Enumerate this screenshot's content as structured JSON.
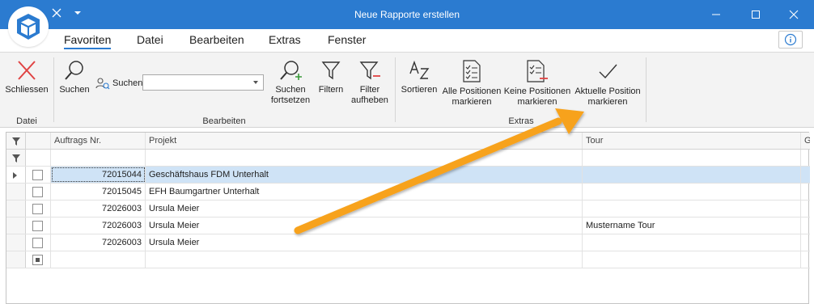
{
  "window": {
    "title": "Neue Rapporte erstellen"
  },
  "menu": {
    "tabs": [
      "Favoriten",
      "Datei",
      "Bearbeiten",
      "Extras",
      "Fenster"
    ]
  },
  "ribbon": {
    "close_label": "Schliessen",
    "group_datei": "Datei",
    "search_btn": "Suchen",
    "search_label": "Suchen",
    "search_value": "",
    "continue_line1": "Suchen",
    "continue_line2": "fortsetzen",
    "filter_label": "Filtern",
    "clear_filter_line1": "Filter",
    "clear_filter_line2": "aufheben",
    "group_bearbeiten": "Bearbeiten",
    "sort_label": "Sortieren",
    "mark_all_line1": "Alle Positionen",
    "mark_all_line2": "markieren",
    "mark_none_line1": "Keine Positionen",
    "mark_none_line2": "markieren",
    "mark_current_line1": "Aktuelle Position",
    "mark_current_line2": "markieren",
    "group_extras": "Extras"
  },
  "grid": {
    "columns": {
      "nr": "Auftrags Nr.",
      "project": "Projekt",
      "tour": "Tour",
      "more": "G"
    },
    "rows": [
      {
        "nr": "72015044",
        "project": "Geschäftshaus FDM Unterhalt",
        "tour": ""
      },
      {
        "nr": "72015045",
        "project": "EFH Baumgartner Unterhalt",
        "tour": ""
      },
      {
        "nr": "72026003",
        "project": "Ursula Meier",
        "tour": ""
      },
      {
        "nr": "72026003",
        "project": "Ursula Meier",
        "tour": "Mustername Tour"
      },
      {
        "nr": "72026003",
        "project": "Ursula Meier",
        "tour": ""
      }
    ]
  },
  "colors": {
    "titlebar": "#2b7bd0",
    "accent": "#2b7bd0",
    "selection": "#cfe3f6",
    "annotation_arrow": "#f7a21b",
    "close_red": "#e04343",
    "add_green": "#3a9a3a"
  }
}
